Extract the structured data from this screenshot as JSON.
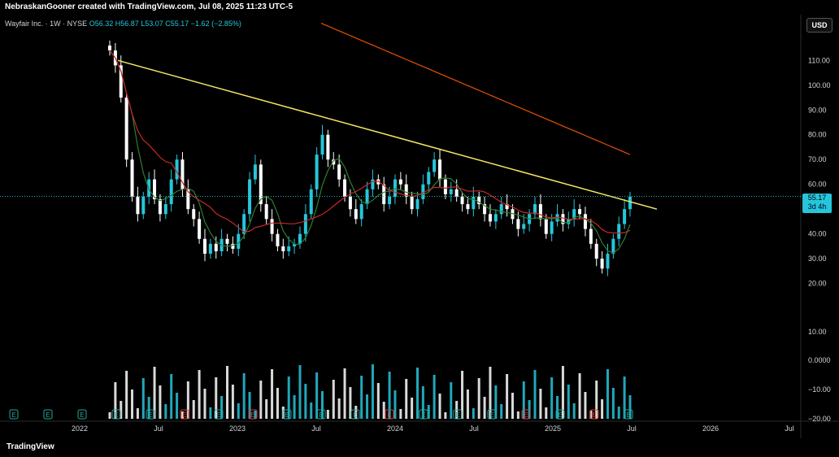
{
  "header": {
    "credit": "NebraskanGooner created with TradingView.com, Jul 08, 2025 11:23 UTC-5"
  },
  "symbol": {
    "name": "Wayfair Inc. · 1W · NYSE",
    "ohlc": "O56.32 H56.87 L53.07 C55.17 −1.62 (−2.85%)"
  },
  "currency": "USD",
  "last_price": {
    "value": "55.17",
    "countdown": "3d 4h"
  },
  "footer": {
    "brand": "TradingView"
  },
  "colors": {
    "bull": "#26c6da",
    "bear": "#ffffff",
    "ma_short": "#2e7d32",
    "ma_mid": "#c62828",
    "ma_long": "#e65100",
    "trendline": "#f5e663"
  },
  "chart_data": {
    "type": "candlestick",
    "price_axis": {
      "ticks": [
        "110.00",
        "100.00",
        "90.00",
        "80.00",
        "70.00",
        "60.00",
        "50.00",
        "40.00",
        "30.00",
        "20.00"
      ],
      "ylim": [
        12,
        116
      ]
    },
    "indicator_axis": {
      "ticks": [
        "10.00",
        "0.0000",
        "−10.00",
        "−20.00"
      ]
    },
    "time_axis": [
      "2022",
      "Jul",
      "2023",
      "Jul",
      "2024",
      "Jul",
      "2025",
      "Jul",
      "2026",
      "Jul"
    ],
    "series": [
      {
        "name": "price_close",
        "x_start": "2022-02",
        "values": [
          114,
          108,
          95,
          70,
          55,
          48,
          55,
          62,
          54,
          48,
          52,
          62,
          70,
          58,
          50,
          46,
          38,
          32,
          36,
          33,
          38,
          36,
          34,
          40,
          48,
          62,
          68,
          52,
          46,
          40,
          35,
          33,
          35,
          36,
          40,
          48,
          58,
          72,
          80,
          70,
          68,
          62,
          55,
          50,
          46,
          52,
          58,
          62,
          60,
          52,
          55,
          62,
          60,
          55,
          50,
          54,
          60,
          65,
          70,
          62,
          56,
          58,
          55,
          52,
          50,
          55,
          52,
          48,
          45,
          48,
          52,
          50,
          46,
          42,
          44,
          48,
          52,
          46,
          40,
          45,
          48,
          44,
          46,
          50,
          48,
          42,
          36,
          30,
          26,
          32,
          38,
          44,
          50,
          55
        ]
      },
      {
        "name": "trendline",
        "points": [
          [
            "2022-04",
            110
          ],
          [
            "2025-08",
            50
          ]
        ]
      }
    ],
    "markers": [
      "E",
      "E",
      "E",
      "E",
      "E",
      "E",
      "E",
      "E",
      "E",
      "E",
      "E",
      "E",
      "E",
      "E",
      "E",
      "E",
      "E",
      "E",
      "E"
    ]
  }
}
